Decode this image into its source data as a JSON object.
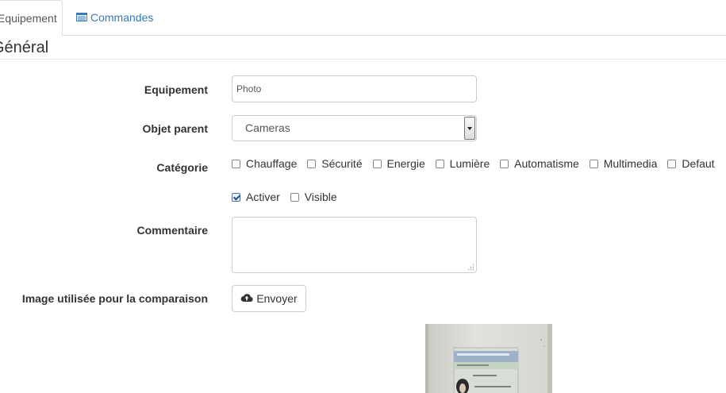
{
  "tabs": [
    {
      "label": "Equipement",
      "active": true
    },
    {
      "label": "Commandes",
      "icon": "list-icon",
      "active": false
    }
  ],
  "section": {
    "legend": "Général"
  },
  "form": {
    "equipement": {
      "label": "Equipement",
      "value": "Photo"
    },
    "objet_parent": {
      "label": "Objet parent",
      "selected": "Cameras"
    },
    "categorie": {
      "label": "Catégorie",
      "options": [
        {
          "label": "Chauffage",
          "checked": false
        },
        {
          "label": "Sécurité",
          "checked": false
        },
        {
          "label": "Energie",
          "checked": false
        },
        {
          "label": "Lumière",
          "checked": false
        },
        {
          "label": "Automatisme",
          "checked": false
        },
        {
          "label": "Multimedia",
          "checked": false
        },
        {
          "label": "Defaut",
          "checked": false
        }
      ]
    },
    "status": {
      "activer": {
        "label": "Activer",
        "checked": true
      },
      "visible": {
        "label": "Visible",
        "checked": false
      }
    },
    "commentaire": {
      "label": "Commentaire",
      "value": ""
    },
    "image": {
      "label": "Image utilisée pour la comparaison",
      "button_label": "Envoyer",
      "button_icon": "cloud-upload-icon"
    }
  },
  "colors": {
    "link": "#337ab7",
    "border": "#cccccc"
  }
}
